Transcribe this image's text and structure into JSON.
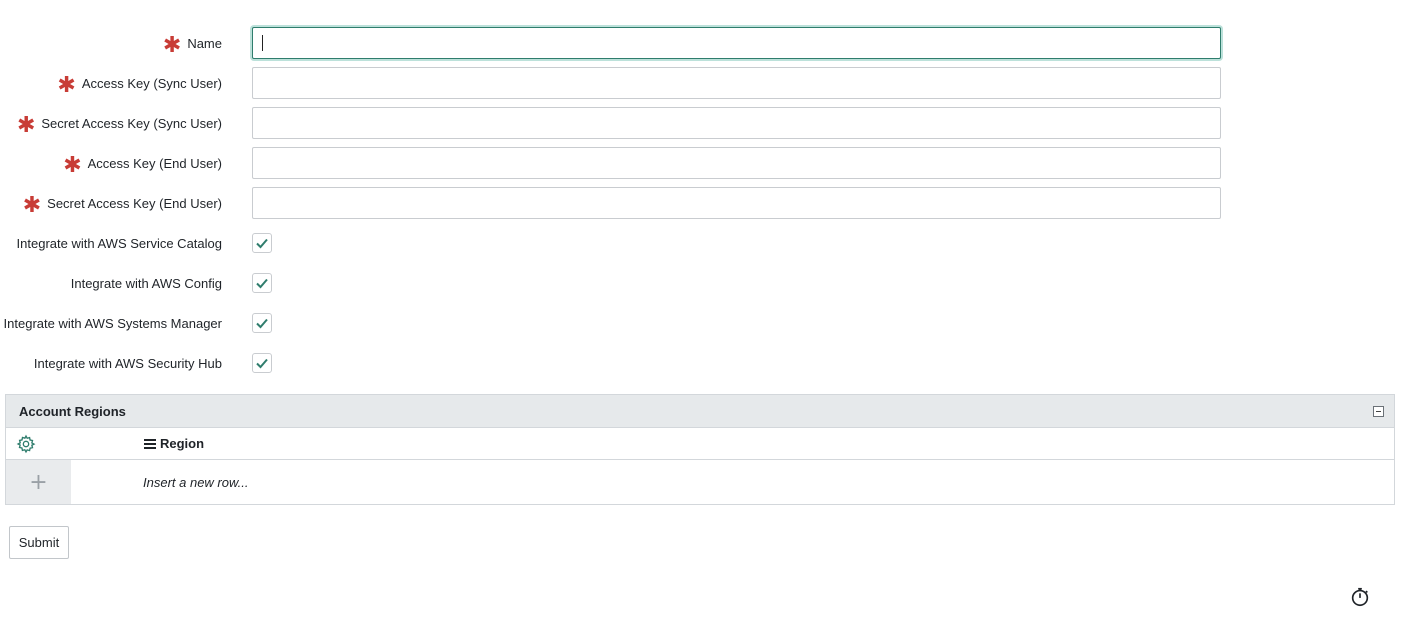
{
  "form": {
    "fields": [
      {
        "label": "Name",
        "required": true,
        "value": "",
        "placeholder": ""
      },
      {
        "label": "Access Key (Sync User)",
        "required": true,
        "value": "",
        "placeholder": ""
      },
      {
        "label": "Secret Access Key (Sync User)",
        "required": true,
        "value": "",
        "placeholder": ""
      },
      {
        "label": "Access Key (End User)",
        "required": true,
        "value": "",
        "placeholder": ""
      },
      {
        "label": "Secret Access Key (End User)",
        "required": true,
        "value": "",
        "placeholder": ""
      }
    ],
    "required_marker": "✱",
    "checkboxes": [
      {
        "label": "Integrate with AWS Service Catalog",
        "checked": true
      },
      {
        "label": "Integrate with AWS Config",
        "checked": true
      },
      {
        "label": "Integrate with AWS Systems Manager",
        "checked": true
      },
      {
        "label": "Integrate with AWS Security Hub",
        "checked": true
      }
    ]
  },
  "regions": {
    "title": "Account Regions",
    "column": "Region",
    "add_symbol": "+",
    "insert_placeholder": "Insert a new row..."
  },
  "actions": {
    "submit_label": "Submit"
  },
  "colors": {
    "required": "#c83c36",
    "accent": "#2f7d6d",
    "header_bg": "#e6e9eb"
  },
  "icons": {
    "settings": "gear-icon",
    "column_menu": "menu-icon",
    "collapse": "collapse-icon",
    "timer": "stopwatch-icon",
    "check": "checkmark-icon"
  }
}
